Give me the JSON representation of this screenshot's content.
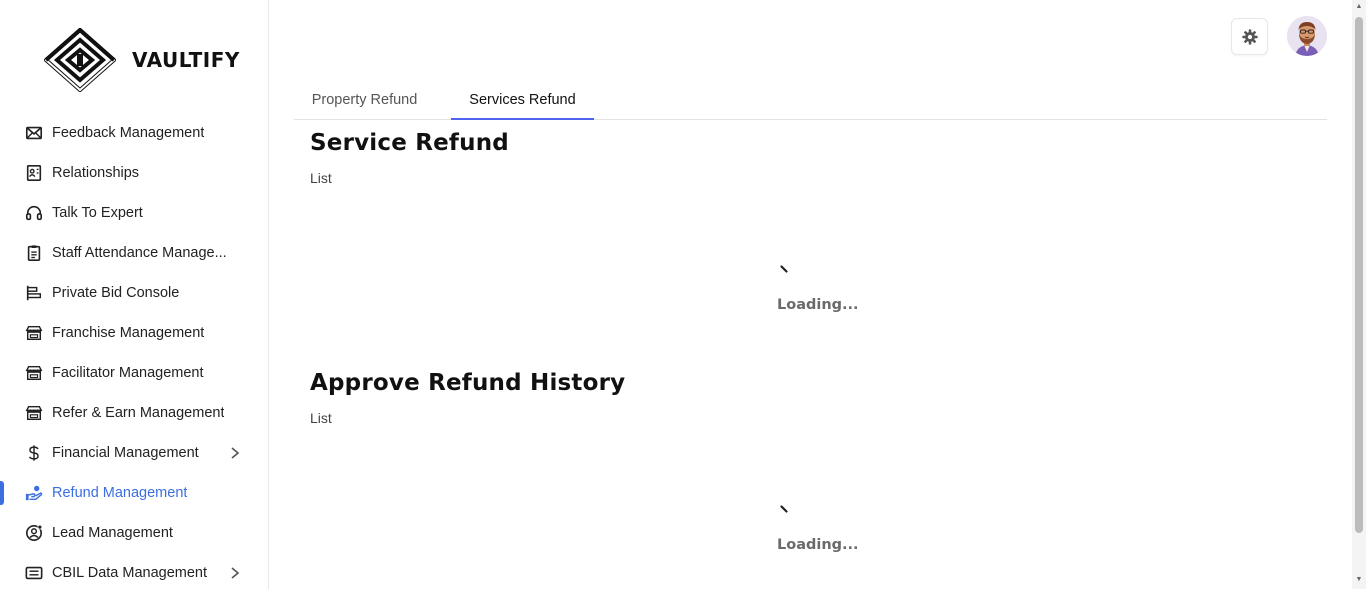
{
  "brand": {
    "name": "VAULTIFY"
  },
  "sidebar": {
    "items": [
      {
        "label": "Feedback Management",
        "icon": "mail-icon"
      },
      {
        "label": "Relationships",
        "icon": "contact-card-icon"
      },
      {
        "label": "Talk To Expert",
        "icon": "headphones-icon"
      },
      {
        "label": "Staff Attendance Manage...",
        "icon": "clipboard-icon"
      },
      {
        "label": "Private Bid Console",
        "icon": "bid-chart-icon"
      },
      {
        "label": "Franchise Management",
        "icon": "store-icon"
      },
      {
        "label": "Facilitator Management",
        "icon": "store-icon"
      },
      {
        "label": "Refer & Earn Management",
        "icon": "store-icon"
      },
      {
        "label": "Financial Management",
        "icon": "dollar-icon",
        "has_submenu": true
      },
      {
        "label": "Refund Management",
        "icon": "hand-coin-icon",
        "active": true
      },
      {
        "label": "Lead Management",
        "icon": "user-target-icon"
      },
      {
        "label": "CBIL Data Management",
        "icon": "list-card-icon",
        "has_submenu": true
      }
    ],
    "active_color": "#3b6fe0"
  },
  "header": {
    "settings_icon": "gear-icon",
    "avatar_icon": "user-avatar"
  },
  "tabs": [
    {
      "label": "Property Refund",
      "active": false
    },
    {
      "label": "Services Refund",
      "active": true
    }
  ],
  "sections": [
    {
      "title": "Service Refund",
      "subtitle": "List",
      "loading_text": "Loading..."
    },
    {
      "title": "Approve Refund History",
      "subtitle": "List",
      "loading_text": "Loading..."
    }
  ],
  "colors": {
    "accent": "#4f63f0",
    "active_nav": "#3b6fe0"
  }
}
